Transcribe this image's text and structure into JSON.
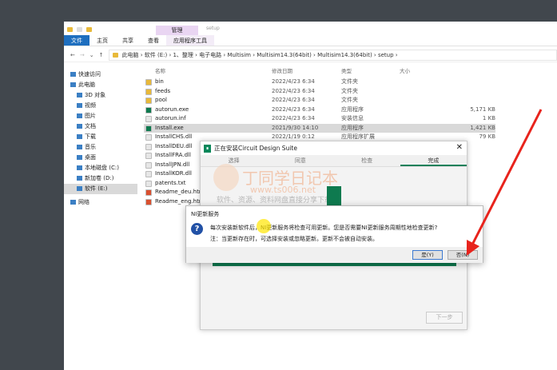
{
  "explorer": {
    "context_tab": "管理",
    "window_title": "setup",
    "ribbon": [
      "文件",
      "主页",
      "共享",
      "查看",
      "应用程序工具"
    ],
    "breadcrumb": [
      "此电脑",
      "软件 (E:)",
      "1、整理",
      "电子电路",
      "Multisim",
      "Multisim14.3(64bit)",
      "Multisim14.3(64bit)",
      "setup"
    ],
    "nav": [
      "快速访问",
      "此电脑",
      "3D 对象",
      "视频",
      "图片",
      "文档",
      "下载",
      "音乐",
      "桌面",
      "本地磁盘 (C:)",
      "新加卷 (D:)",
      "软件 (E:)",
      "网络"
    ],
    "columns": {
      "name": "名称",
      "date": "修改日期",
      "type": "类型",
      "size": "大小"
    },
    "files": [
      {
        "name": "bin",
        "date": "2022/4/23 6:34",
        "type": "文件夹",
        "size": ""
      },
      {
        "name": "feeds",
        "date": "2022/4/23 6:34",
        "type": "文件夹",
        "size": ""
      },
      {
        "name": "pool",
        "date": "2022/4/23 6:34",
        "type": "文件夹",
        "size": ""
      },
      {
        "name": "autorun.exe",
        "date": "2022/4/23 6:34",
        "type": "应用程序",
        "size": "5,171 KB"
      },
      {
        "name": "autorun.inf",
        "date": "2022/4/23 6:34",
        "type": "安装信息",
        "size": "1 KB"
      },
      {
        "name": "Install.exe",
        "date": "2021/9/30 14:10",
        "type": "应用程序",
        "size": "1,421 KB"
      },
      {
        "name": "InstallCHS.dll",
        "date": "2022/1/19 0:12",
        "type": "应用程序扩展",
        "size": "79 KB"
      },
      {
        "name": "InstallDEU.dll",
        "date": "",
        "type": "",
        "size": ""
      },
      {
        "name": "InstallFRA.dll",
        "date": "",
        "type": "",
        "size": ""
      },
      {
        "name": "InstallJPN.dll",
        "date": "",
        "type": "",
        "size": ""
      },
      {
        "name": "InstallKOR.dll",
        "date": "",
        "type": "",
        "size": ""
      },
      {
        "name": "patents.txt",
        "date": "",
        "type": "",
        "size": ""
      },
      {
        "name": "Readme_deu.html",
        "date": "",
        "type": "",
        "size": ""
      },
      {
        "name": "Readme_eng.html",
        "date": "",
        "type": "",
        "size": ""
      }
    ]
  },
  "installer": {
    "title": "正在安装Circuit Design Suite",
    "tabs": [
      "选择",
      "同意",
      "检查",
      "完成"
    ],
    "watermark": {
      "title": "丁同学日记本",
      "url": "www.ts006.net",
      "slogan": "软件、资源、资料网盘直接分享下载"
    },
    "progress": 1.0,
    "next_label": "下一步"
  },
  "message_box": {
    "title": "NI更新服务",
    "line1": "每次安装新软件后，NI更新服务将检查可用更新。您是否需要NI更新服务周期性地检查更新?",
    "line2": "注：当更新存在时，可选择安装或忽略更新。更新不会被自动安装。",
    "yes": "是(Y)",
    "no": "否(N)"
  },
  "colors": {
    "accent": "#0e7a4f",
    "arrow": "#e8231c"
  }
}
